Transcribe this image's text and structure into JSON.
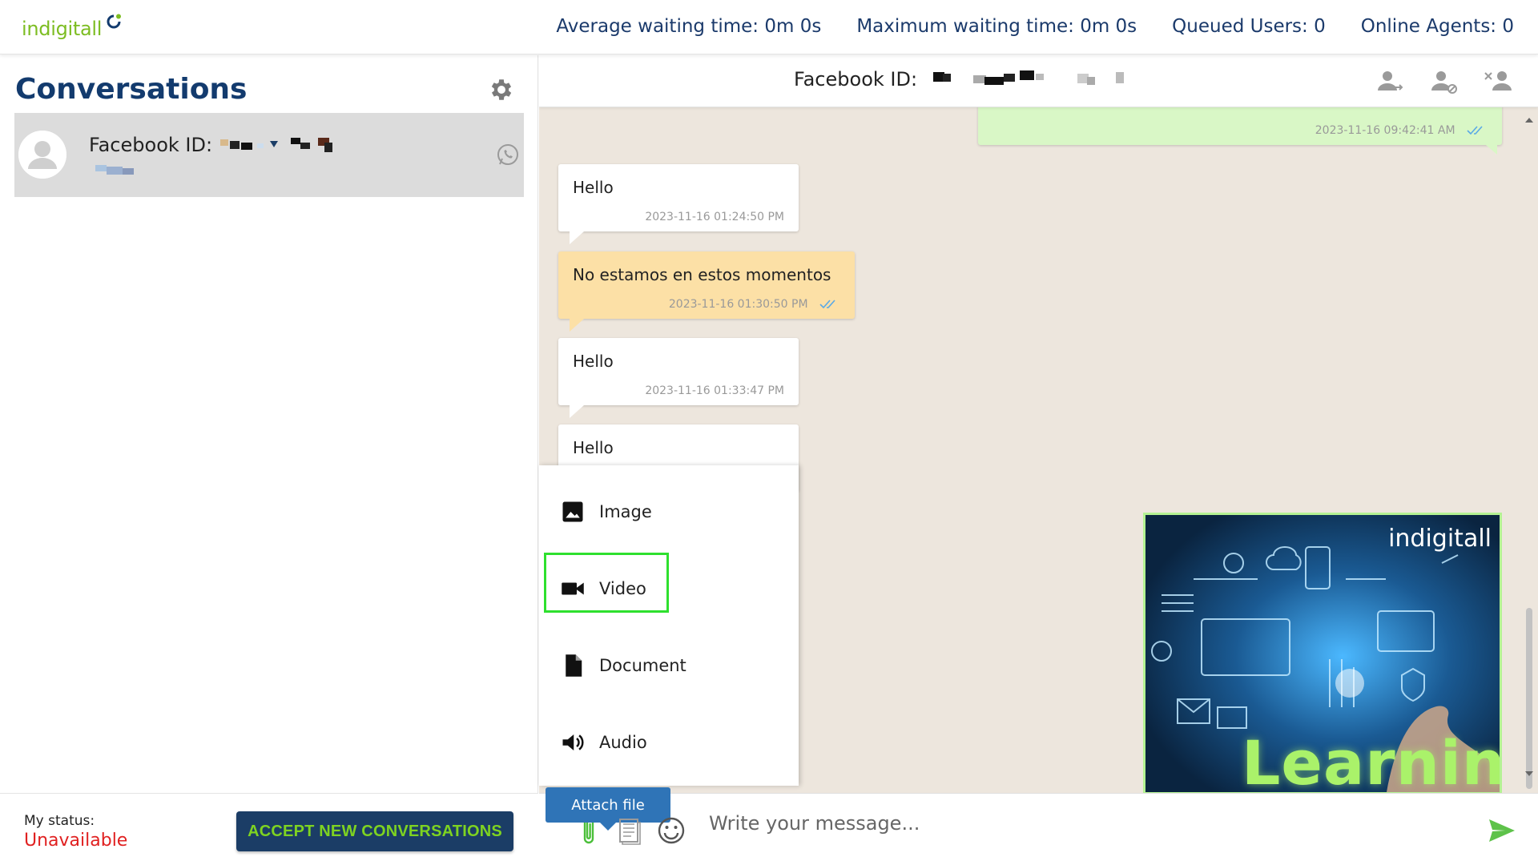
{
  "brand": {
    "name": "indigitall"
  },
  "stats": {
    "avg_wait_label": "Average waiting time:",
    "avg_wait_value": "0m 0s",
    "max_wait_label": "Maximum waiting time:",
    "max_wait_value": "0m 0s",
    "queued_label": "Queued Users:",
    "queued_value": "0",
    "online_label": "Online Agents:",
    "online_value": "0"
  },
  "sidebar": {
    "title": "Conversations",
    "conversations": [
      {
        "name_label": "Facebook ID:",
        "channel": "whatsapp-icon"
      }
    ]
  },
  "status": {
    "label": "My status:",
    "value": "Unavailable",
    "accept_label": "ACCEPT NEW CONVERSATIONS"
  },
  "chat": {
    "header_label": "Facebook ID:",
    "messages": [
      {
        "type": "agent",
        "text": "",
        "time": "2023-11-16 09:42:41 AM",
        "read": true
      },
      {
        "type": "user",
        "text": "Hello",
        "time": "2023-11-16 01:24:50 PM"
      },
      {
        "type": "auto",
        "text": "No estamos en estos momentos",
        "time": "2023-11-16 01:30:50 PM",
        "read": true
      },
      {
        "type": "user",
        "text": "Hello",
        "time": "2023-11-16 01:33:47 PM"
      },
      {
        "type": "user",
        "text": "Hello",
        "time": ""
      }
    ],
    "image_card": {
      "brand": "indigitall",
      "word": "Learning"
    },
    "attach_menu": {
      "items": [
        {
          "label": "Image",
          "icon": "image-icon"
        },
        {
          "label": "Video",
          "icon": "video-icon",
          "selected": true
        },
        {
          "label": "Document",
          "icon": "document-icon"
        },
        {
          "label": "Audio",
          "icon": "audio-icon"
        }
      ]
    },
    "compose": {
      "placeholder": "Write your message...",
      "attach_tooltip": "Attach file"
    }
  },
  "colors": {
    "brand_green": "#7dbd22",
    "navy": "#133b6e",
    "accept_bg": "#1b3d66",
    "accept_text": "#7ed321",
    "unavailable": "#e02020",
    "tooltip": "#2f74b7",
    "auto_msg": "#fce0a6",
    "agent_msg": "#d9f7c6",
    "chat_bg": "#ede6dd",
    "selection": "#2ee02e"
  }
}
